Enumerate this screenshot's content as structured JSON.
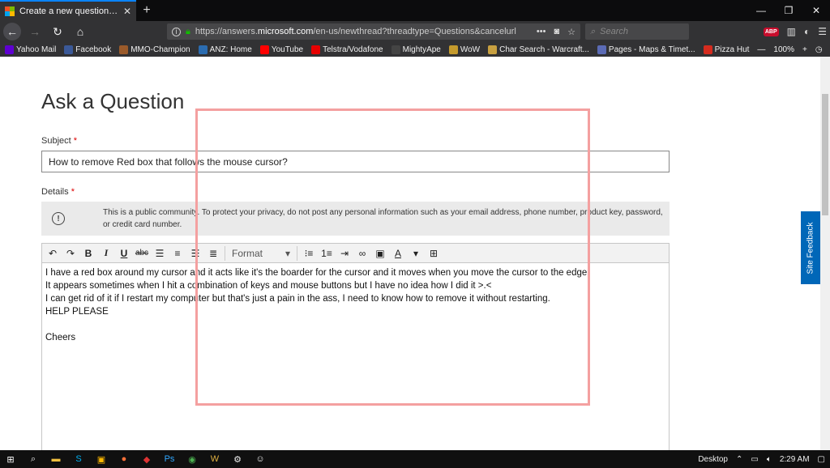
{
  "browser": {
    "tab_title": "Create a new question or start a",
    "url_prefix": "https://answers.",
    "url_domain": "microsoft.com",
    "url_rest": "/en-us/newthread?threadtype=Questions&cancelurl",
    "search_placeholder": "Search",
    "zoom": "100%",
    "bookmarks": [
      {
        "label": "Yahoo Mail",
        "color": "#5f01d1"
      },
      {
        "label": "Facebook",
        "color": "#3b5998"
      },
      {
        "label": "MMO-Champion",
        "color": "#9a5a2a"
      },
      {
        "label": "ANZ: Home",
        "color": "#2b6cb0"
      },
      {
        "label": "YouTube",
        "color": "#ff0000"
      },
      {
        "label": "Telstra/Vodafone",
        "color": "#e60000"
      },
      {
        "label": "MightyApe",
        "color": "#444444"
      },
      {
        "label": "WoW",
        "color": "#c49a2c"
      },
      {
        "label": "Char Search - Warcraft...",
        "color": "#c8a040"
      },
      {
        "label": "Pages - Maps & Timet...",
        "color": "#5b6bb5"
      },
      {
        "label": "Pizza Hut",
        "color": "#d52b1e"
      }
    ]
  },
  "page": {
    "heading": "Ask a Question",
    "subject_label": "Subject",
    "required_mark": "*",
    "subject_value": "How to remove Red box that follows the mouse cursor?",
    "details_label": "Details",
    "notice_text": "This is a public community. To protect your privacy, do not post any personal information such as your email address, phone number, product key, password, or credit card number.",
    "format_label": "Format",
    "body_lines": [
      "I have a red box around my cursor and it acts like it's the boarder for the cursor and it moves when you move the cursor to the edge.",
      "It appears sometimes when I hit a combination of keys and mouse buttons but I have no idea how I did it >.<",
      "I can get rid of it if I restart my computer but that's just a pain in the ass, I need to know how to remove it without restarting.",
      "HELP PLEASE",
      "",
      "Cheers"
    ],
    "site_feedback": "Site Feedback"
  },
  "taskbar": {
    "desktop_label": "Desktop",
    "time": "2:29 AM"
  },
  "colors": {
    "red_box": "#f4a0a0",
    "accent": "#0067b8"
  }
}
